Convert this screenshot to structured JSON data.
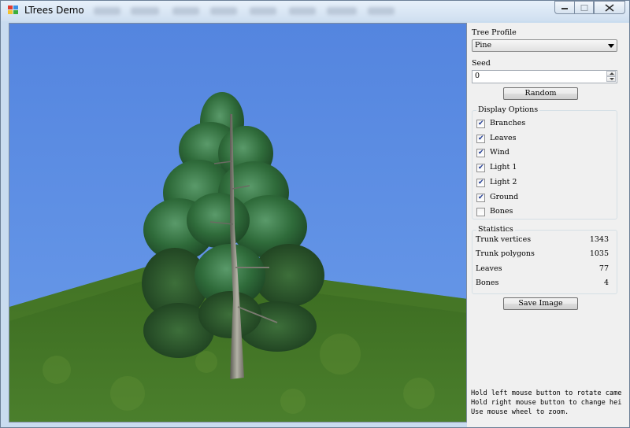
{
  "window": {
    "title": "LTrees Demo"
  },
  "panel": {
    "tree_profile": {
      "label": "Tree Profile",
      "selected": "Pine"
    },
    "seed": {
      "label": "Seed",
      "value": "0"
    },
    "random_button": "Random",
    "display_options": {
      "title": "Display Options",
      "items": [
        {
          "label": "Branches",
          "checked": true
        },
        {
          "label": "Leaves",
          "checked": true
        },
        {
          "label": "Wind",
          "checked": true
        },
        {
          "label": "Light 1",
          "checked": true
        },
        {
          "label": "Light 2",
          "checked": true
        },
        {
          "label": "Ground",
          "checked": true
        },
        {
          "label": "Bones",
          "checked": false
        }
      ]
    },
    "statistics": {
      "title": "Statistics",
      "rows": [
        {
          "name": "Trunk vertices",
          "value": "1343"
        },
        {
          "name": "Trunk polygons",
          "value": "1035"
        },
        {
          "name": "Leaves",
          "value": "77"
        },
        {
          "name": "Bones",
          "value": "4"
        }
      ]
    },
    "save_button": "Save Image",
    "hints": [
      "Hold left mouse button to rotate came",
      "Hold right mouse button to change hei",
      "Use mouse wheel to zoom."
    ]
  },
  "colors": {
    "sky": "#5b8fe3",
    "grass": "#3f6f24",
    "foliage": "#2f6a34",
    "trunk": "#8a8a80"
  },
  "icons": [
    "app-icon",
    "minimize-icon",
    "maximize-icon",
    "close-icon",
    "dropdown-arrow-icon",
    "checkmark-icon"
  ]
}
